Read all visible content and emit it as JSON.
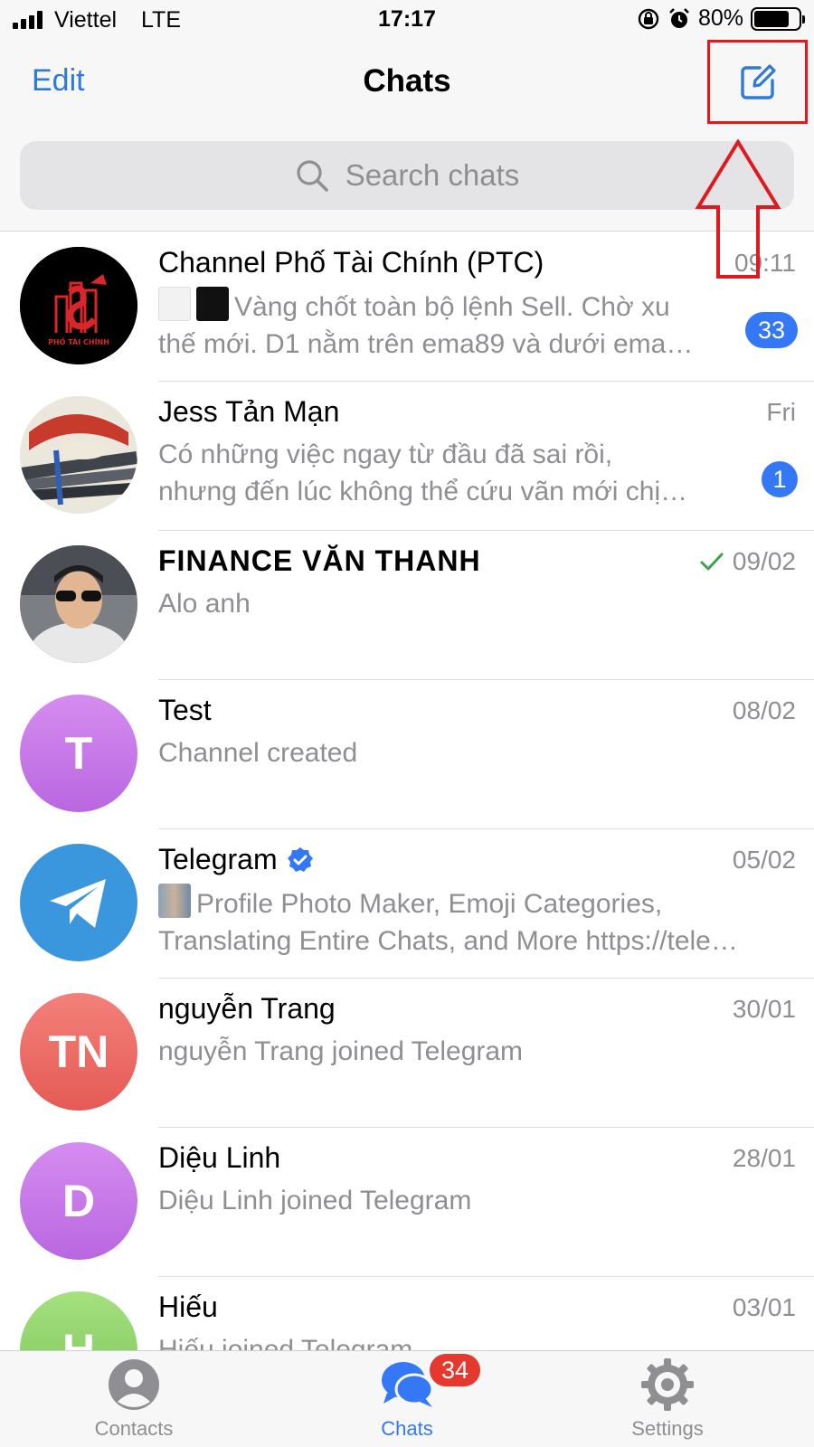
{
  "status_bar": {
    "carrier": "Viettel",
    "network": "LTE",
    "time": "17:17",
    "battery": "80%",
    "battery_level": 0.8,
    "icons": [
      "orientation-lock-icon",
      "alarm-icon"
    ]
  },
  "nav": {
    "edit_label": "Edit",
    "title": "Chats",
    "compose_icon": "compose-icon"
  },
  "search": {
    "placeholder": "Search chats"
  },
  "chats": [
    {
      "name": "Channel Phố Tài Chính (PTC)",
      "time": "09:11",
      "preview_lines": [
        "Vàng chốt toàn bộ lệnh Sell. Chờ xu",
        "thế mới. D1 nằm trên ema89 và dưới ema…"
      ],
      "unread": "33",
      "avatar_color": "#000000"
    },
    {
      "name": "Jess Tản Mạn",
      "time": "Fri",
      "preview_lines": [
        "Có những việc ngay từ đầu đã sai rồi,",
        "nhưng đến lúc không thể cứu vãn mới chị…"
      ],
      "unread": "1",
      "avatar_color": "#c0392b"
    },
    {
      "name": "FINANCE VĂN THANH",
      "time": "09/02",
      "read_check": true,
      "preview_lines": [
        "Alo anh"
      ],
      "avatar_color": "#6d6d6d"
    },
    {
      "name": "Test",
      "time": "08/02",
      "preview_lines": [
        "Channel created"
      ],
      "avatar_initials": "T",
      "avatar_color": "#c97ae8"
    },
    {
      "name": "Telegram",
      "verified": true,
      "time": "05/02",
      "preview_lines": [
        "Profile Photo Maker, Emoji Categories,",
        "Translating Entire Chats, and More https://tele…"
      ],
      "avatar_color": "#3a96dd"
    },
    {
      "name": "nguyễn Trang",
      "time": "30/01",
      "preview_lines": [
        "nguyễn Trang joined Telegram"
      ],
      "avatar_initials": "TN",
      "avatar_color": "#ee6e62"
    },
    {
      "name": "Diệu Linh",
      "time": "28/01",
      "preview_lines": [
        "Diệu Linh joined Telegram"
      ],
      "avatar_initials": "D",
      "avatar_color": "#c97ae8"
    },
    {
      "name": "Hiếu",
      "time": "03/01",
      "preview_lines": [
        "Hiếu joined Telegram"
      ],
      "avatar_initials": "H",
      "avatar_color": "#8fd16b"
    }
  ],
  "tabs": [
    {
      "label": "Contacts",
      "icon": "contacts-icon",
      "active": false
    },
    {
      "label": "Chats",
      "icon": "chats-icon",
      "active": true,
      "badge": "34"
    },
    {
      "label": "Settings",
      "icon": "settings-icon",
      "active": false
    }
  ],
  "colors": {
    "accent": "#2f7ad9",
    "badge_blue": "#3478f6",
    "badge_red": "#e5392f",
    "annotation_red": "#e0191e",
    "read_check": "#3ca34a"
  }
}
